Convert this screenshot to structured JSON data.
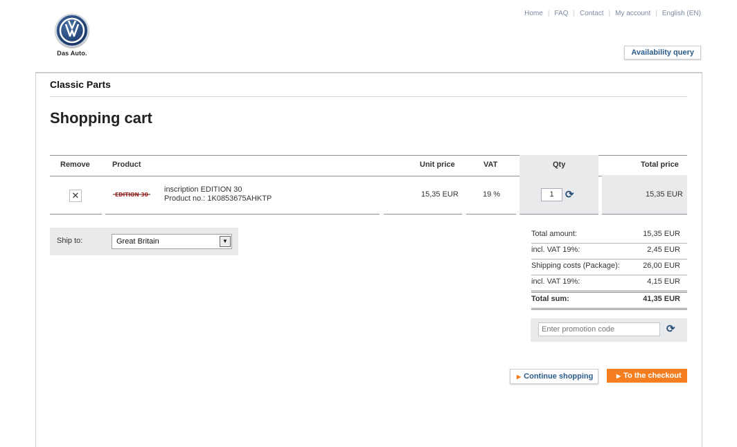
{
  "brand": {
    "tagline": "Das Auto."
  },
  "topnav": [
    "Home",
    "FAQ",
    "Contact",
    "My account",
    "English (EN)"
  ],
  "availability_button": "Availability query",
  "section_title": "Classic Parts",
  "page_title": "Shopping cart",
  "table": {
    "headers": {
      "remove": "Remove",
      "product": "Product",
      "unit_price": "Unit price",
      "vat": "VAT",
      "qty": "Qty",
      "total": "Total price"
    },
    "rows": [
      {
        "name": "inscription EDITION 30",
        "product_no": "Product no.: 1K0853675AHKTP",
        "unit_price": "15,35 EUR",
        "vat": "19 %",
        "qty": "1",
        "total": "15,35 EUR",
        "image_text": "EDITION 30"
      }
    ]
  },
  "ship_to": {
    "label": "Ship to:",
    "value": "Great Britain"
  },
  "totals": [
    {
      "label": "Total amount:",
      "value": "15,35 EUR"
    },
    {
      "label": "incl. VAT 19%:",
      "value": "2,45 EUR"
    },
    {
      "label": "Shipping costs (Package):",
      "value": "26,00 EUR"
    },
    {
      "label": "incl. VAT 19%:",
      "value": "4,15 EUR"
    },
    {
      "label": "Total sum:",
      "value": "41,35 EUR"
    }
  ],
  "promo": {
    "placeholder": "Enter promotion code"
  },
  "buttons": {
    "continue": "Continue shopping",
    "checkout": "To the checkout"
  },
  "colors": {
    "accent": "#f47e20",
    "link": "#2a5b8c",
    "panel_bg": "#e8eaeb"
  },
  "icons": {
    "remove": "close-icon",
    "refresh": "refresh-icon",
    "dropdown": "chevron-down-icon"
  }
}
